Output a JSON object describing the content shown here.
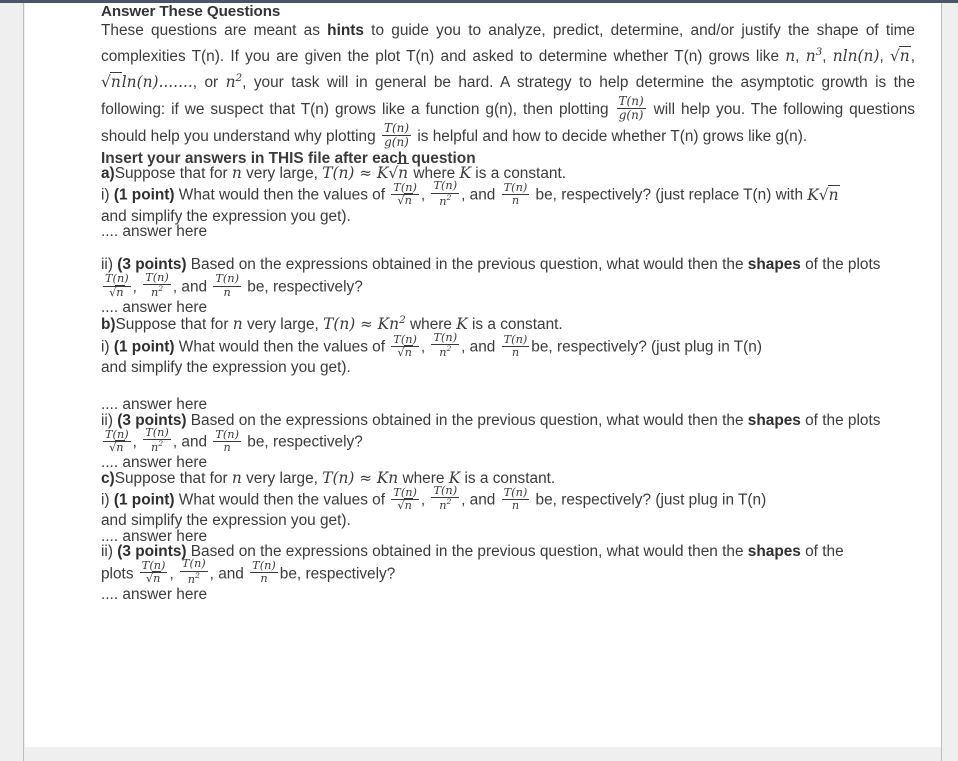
{
  "document": {
    "title": "Answer These Questions",
    "intro": {
      "seg1": "These questions are meant as ",
      "hints": "hints",
      "seg2": " to guide you to analyze, predict, determine, and/or justify the shape of time complexities T(n). If you are given the plot T(n) and asked to determine whether T(n) grows like ",
      "m_n": "n",
      "m_n3": "n",
      "m_n3_sup": "3",
      "comma1": ", ",
      "m_nlnn": "nln(n)",
      "comma2": ", ",
      "m_sqrtn": "n",
      "comma3": ", ",
      "m_sqrtnlnn_rad": "n",
      "m_sqrtnlnn_tail": "ln(n)",
      "dots": ".......",
      "seg3": ", or ",
      "m_n2": "n",
      "m_n2_sup": "2",
      "seg4": ", your task will in general be hard. A strategy to help determine the asymptotic growth is the following: if we suspect that T(n) grows like a function g(n), then plotting ",
      "seg5": " will help you. The following questions should help you understand why plotting ",
      "seg6": " is helpful and how to decide whether T(n) grows like g(n).",
      "frac_Tg_num": "T(n)",
      "frac_Tg_den": "g(n)"
    },
    "red_note": "Insert your answers in THIS file after each question",
    "answer_placeholder": ".... answer here",
    "simplify_note": "and simplify the expression you get).",
    "frac": {
      "num": "T(n)",
      "den_sqrt_n": "n",
      "den_n2": "n",
      "den_n2_sup": "2",
      "den_n": "n"
    },
    "parts": [
      {
        "letter": "a)",
        "suppose_pre": "Suppose that for ",
        "suppose_n": "n",
        "suppose_mid": " very large, ",
        "formula_T": "T(n)",
        "formula_approx": "≈",
        "formula_K": "K",
        "formula_rad": "n",
        "formula_tail": "",
        "where_pre": " where ",
        "where_K": "K",
        "where_post": " is a constant.",
        "i_label": "i)",
        "i_points": "(1 point)",
        "i_text_pre": " What would then the values of ",
        "i_text_mid": ", ",
        "i_text_and": ", and ",
        "i_text_post": " be, respectively? (just replace T(n) with ",
        "i_text_K": "K",
        "i_text_rad": "n",
        "ii_label": "ii)",
        "ii_points": "(3 points)",
        "ii_text_pre": " Based on the expressions obtained in the previous question, what would then the ",
        "ii_shapes": "shapes",
        "ii_text_post": " of the plots",
        "ii_tail": " be, respectively?"
      },
      {
        "letter": "b)",
        "suppose_pre": "Suppose that for ",
        "suppose_n": "n",
        "suppose_mid": " very large, ",
        "formula_T": "T(n)",
        "formula_approx": "≈",
        "formula_K": "Kn",
        "formula_sup": "2",
        "where_pre": " where ",
        "where_K": "K",
        "where_post": " is a constant.",
        "i_label": "i)",
        "i_points": "(1 point)",
        "i_text_pre": " What would then the values of ",
        "i_text_mid": ", ",
        "i_text_and": ", and ",
        "i_text_post": "be, respectively?  (just plug in T(n)",
        "ii_label": "ii)",
        "ii_points": "(3 points)",
        "ii_text_pre": " Based on the expressions obtained in the previous question, what would then the ",
        "ii_shapes": "shapes",
        "ii_text_post": " of the plots",
        "ii_tail": " be, respectively?"
      },
      {
        "letter": "c)",
        "suppose_pre": "Suppose that for ",
        "suppose_n": "n",
        "suppose_mid": " very large, ",
        "formula_T": "T(n)",
        "formula_approx": "≈",
        "formula_K": "Kn",
        "where_pre": " where ",
        "where_K": "K",
        "where_post": " is a constant.",
        "i_label": "i)",
        "i_points": "(1 point)",
        "i_text_pre": " What would then the values of ",
        "i_text_mid": ", ",
        "i_text_and": ", and ",
        "i_text_post": " be, respectively? (just plug in T(n)",
        "ii_label": "ii)",
        "ii_points": "(3 points)",
        "ii_text_pre": " Based on the expressions obtained in the previous question, what would then the ",
        "ii_shapes": "shapes",
        "ii_text_post": " of the",
        "ii_plots_word": "plots ",
        "ii_tail": "be, respectively?"
      }
    ]
  },
  "colors": {
    "chrome": "#4a5568",
    "gutter": "#efefef",
    "page": "#ffffff",
    "text": "#3b3b3b",
    "red": "#f5291b",
    "blue": "#4aa3ec",
    "gray": "#818181",
    "border": "#b9bec4"
  }
}
